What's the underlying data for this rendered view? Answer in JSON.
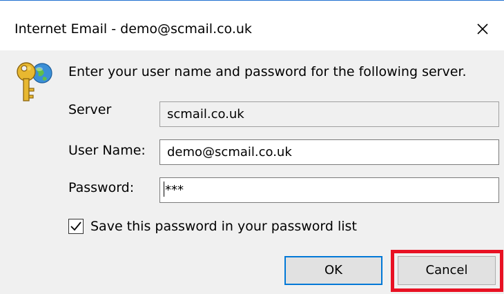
{
  "window": {
    "title": "Internet Email - demo@scmail.co.uk",
    "close_icon": "close-icon"
  },
  "prompt": {
    "icon": "key-globe-icon",
    "text": "Enter your user name and password for the following server."
  },
  "fields": {
    "server": {
      "label": "Server",
      "value": "scmail.co.uk",
      "readonly": true
    },
    "user_name": {
      "label": "User Name:",
      "value": "demo@scmail.co.uk"
    },
    "password": {
      "label": "Password:",
      "value": "***"
    }
  },
  "save_password": {
    "label": "Save this password in your password list",
    "checked": true
  },
  "buttons": {
    "ok": "OK",
    "cancel": "Cancel"
  },
  "colors": {
    "accent": "#0078d7",
    "highlight": "#e81123",
    "dialog_bg": "#f0f0f0"
  }
}
